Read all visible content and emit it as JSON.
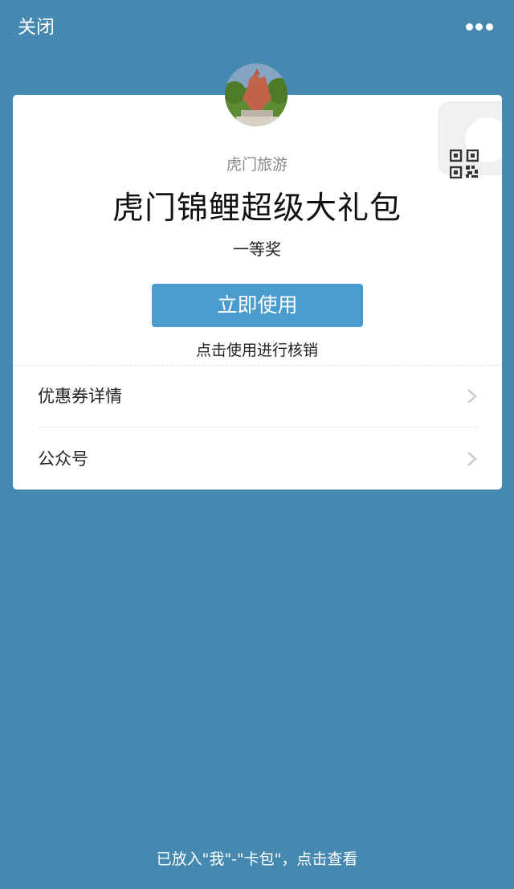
{
  "topbar": {
    "close_label": "关闭",
    "more_icon": "more-dots-icon"
  },
  "card": {
    "merchant_name": "虎门旅游",
    "title": "虎门锦鲤超级大礼包",
    "subtitle": "一等奖",
    "use_button_label": "立即使用",
    "use_hint": "点击使用进行核销",
    "qr_icon": "qr-code-icon"
  },
  "rows": [
    {
      "label": "优惠券详情",
      "icon": "chevron-right-icon"
    },
    {
      "label": "公众号",
      "icon": "chevron-right-icon"
    }
  ],
  "footer": {
    "link_text": "已放入\"我\"-\"卡包\"，点击查看"
  },
  "colors": {
    "background": "#4588b0",
    "button": "#4a9bce",
    "card": "#ffffff"
  }
}
